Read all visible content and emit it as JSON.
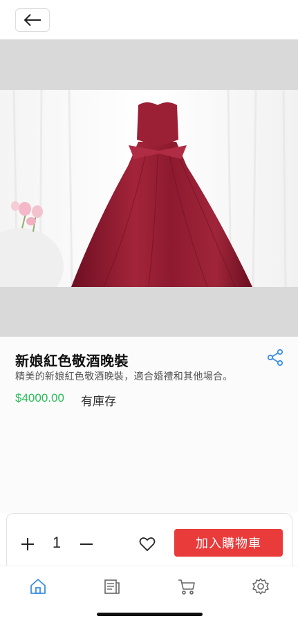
{
  "header": {
    "back_icon": "arrow-left-icon"
  },
  "product": {
    "title": "新娘紅色敬酒晚裝",
    "description": "精美的新娘紅色敬酒晚裝，適合婚禮和其他場合。",
    "price": "$4000.00",
    "stock": "有庫存",
    "image_subject": "red-satin-strapless-ball-gown"
  },
  "cart": {
    "quantity": "1",
    "add_to_cart_label": "加入購物車",
    "plus_icon": "plus-icon",
    "minus_icon": "minus-icon",
    "wishlist_icon": "heart-icon"
  },
  "tabbar": {
    "items": [
      {
        "icon": "home-icon",
        "active": true
      },
      {
        "icon": "catalog-icon",
        "active": false
      },
      {
        "icon": "cart-icon",
        "active": false
      },
      {
        "icon": "settings-icon",
        "active": false
      }
    ]
  },
  "colors": {
    "price": "#2dbb5c",
    "accent_button": "#ea3b3b",
    "active_tab": "#3b8ee6",
    "inactive_tab": "#666666",
    "share_icon": "#3b8ee6"
  }
}
